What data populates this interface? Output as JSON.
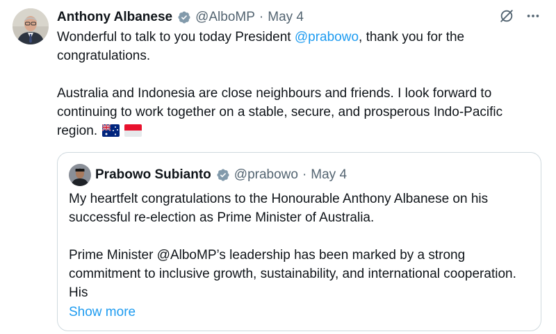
{
  "tweet": {
    "author_name": "Anthony Albanese",
    "handle": "@AlboMP",
    "separator": "·",
    "date": "May 4",
    "text_intro": "Wonderful to talk to you today President ",
    "mention": "@prabowo",
    "text_rest": ", thank you for the congratulations.",
    "paragraph2": "Australia and Indonesia are close neighbours and friends. I look forward to continuing to work together on a stable, secure, and prosperous Indo-Pacific region."
  },
  "quoted": {
    "author_name": "Prabowo Subianto",
    "handle": "@prabowo",
    "separator": "·",
    "date": "May 4",
    "paragraph1": "My heartfelt congratulations to the Honourable Anthony Albanese on his successful re-election as Prime Minister of Australia.",
    "paragraph2": "Prime Minister @AlboMP’s leadership has been marked by a strong commitment to inclusive growth, sustainability, and international cooperation. His",
    "show_more": "Show more"
  },
  "icons": {
    "verified": "verified-badge-icon",
    "grok": "grok-icon",
    "more": "more-options-icon",
    "flag1": "australia-flag-icon",
    "flag2": "indonesia-flag-icon"
  },
  "colors": {
    "link": "#1d9bf0",
    "meta": "#536471",
    "text": "#0f1419",
    "border": "#cfd9de",
    "verified": "#829aab"
  }
}
